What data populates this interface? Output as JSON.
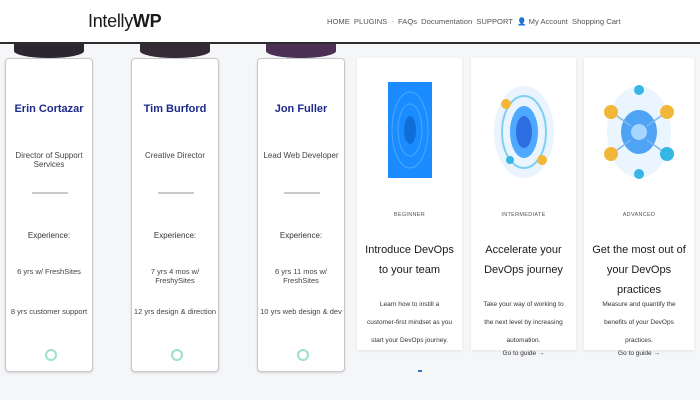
{
  "header": {
    "logo_plain": "Intelly",
    "logo_bold": "WP",
    "nav": [
      "HOME",
      "PLUGINS",
      "-",
      "FAQs",
      "Documentation",
      "SUPPORT",
      "👤 My Account",
      "Shopping Cart"
    ]
  },
  "team": [
    {
      "name": "Erin Cortazar",
      "role": "Director of Support Services",
      "experience_label": "Experience:",
      "line1": "6 yrs w/ FreshSites",
      "line2": "8 yrs customer support"
    },
    {
      "name": "Tim Burford",
      "role": "Creative Director",
      "experience_label": "Experience:",
      "line1": "7 yrs 4 mos w/ FreshySites",
      "line2": "12 yrs design & direction"
    },
    {
      "name": "Jon Fuller",
      "role": "Lead Web Developer",
      "experience_label": "Experience:",
      "line1": "6 yrs 11 mos w/ FreshSites",
      "line2": "10 yrs web design & dev"
    }
  ],
  "guides": [
    {
      "level": "BEGINNER",
      "title": "Introduce DevOps to your team",
      "description": "Learn how to instill a customer-first mindset as you start your DevOps journey.",
      "link": ""
    },
    {
      "level": "INTERMEDIATE",
      "title": "Accelerate your DevOps journey",
      "description": "Take your way of working to the next level by increasing automation.",
      "link": "Go to guide →"
    },
    {
      "level": "ADVANCED",
      "title": "Get the most out of your DevOps practices",
      "description": "Measure and quantify the benefits of your DevOps practices.",
      "link": "Go to guide →"
    }
  ],
  "colors": {
    "name_blue": "#1c2a8c",
    "accent_green": "#9ee1c5",
    "beginner_blue": "#1a8cff"
  }
}
